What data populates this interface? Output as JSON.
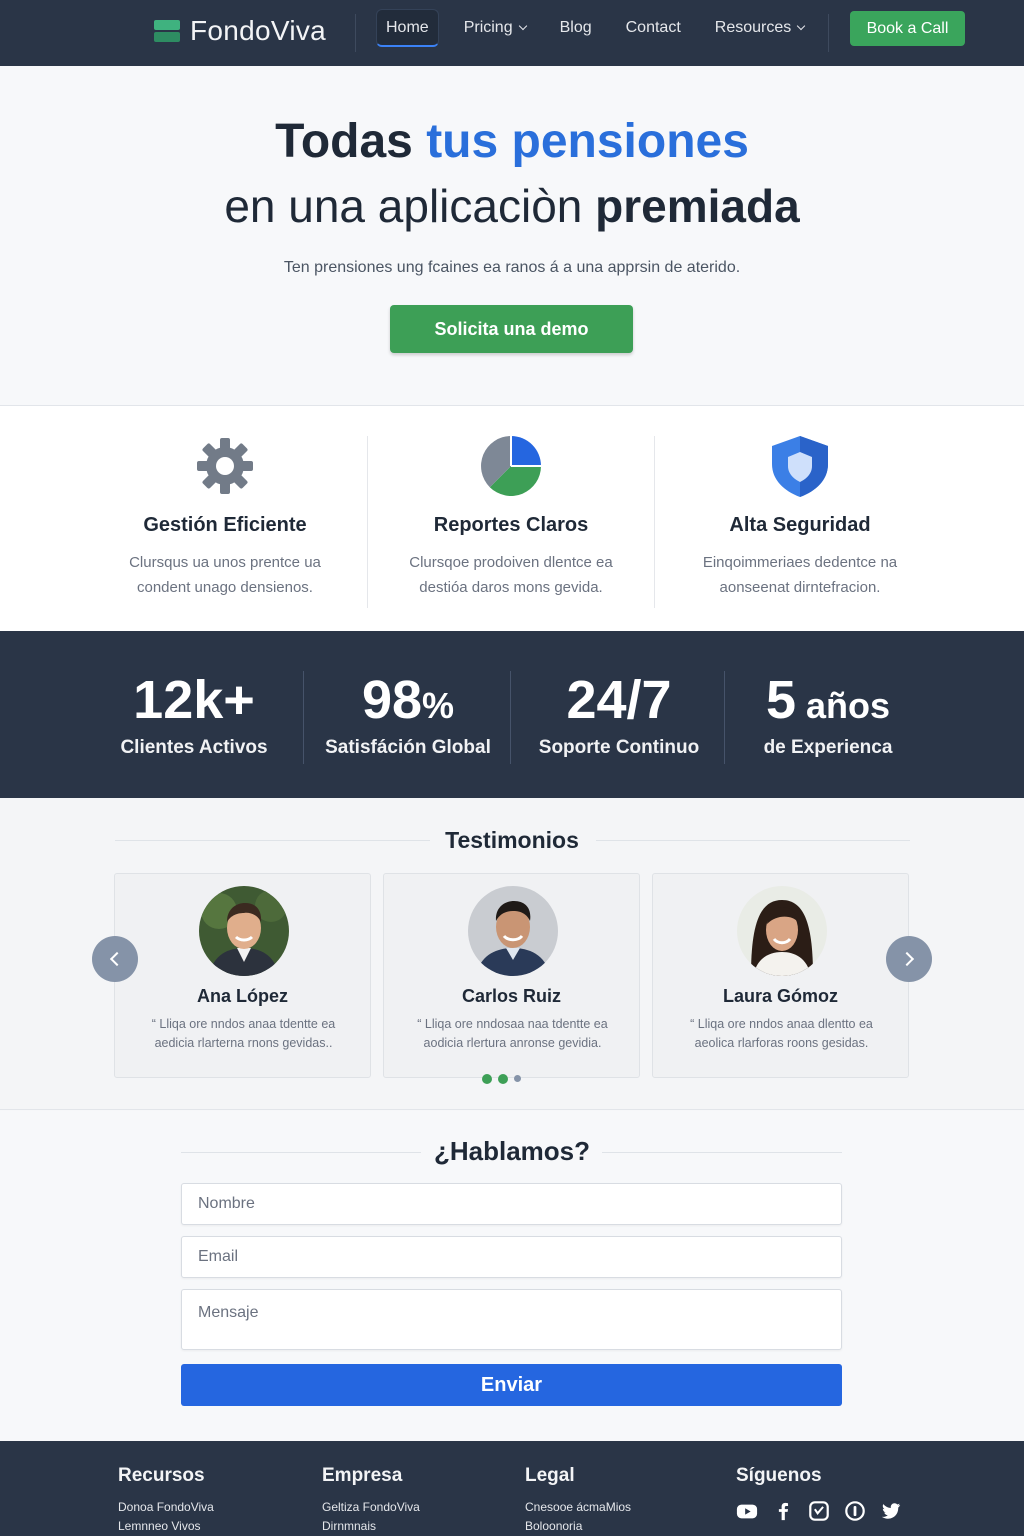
{
  "nav": {
    "brand": "FondoViva",
    "links": [
      {
        "label": "Home"
      },
      {
        "label": "Pricing"
      },
      {
        "label": "Blog"
      },
      {
        "label": "Contact"
      },
      {
        "label": "Resources"
      }
    ],
    "cta": "Book a Call"
  },
  "hero": {
    "title_part1": "Todas ",
    "title_accent": "tus pensiones",
    "title_line2_normal": "en una aplicaciòn ",
    "title_line2_bold": "premiada",
    "subtitle": "Ten prensiones ung fcaines ea ranos á a una apprsin de aterido.",
    "button": "Solicita una demo"
  },
  "features": [
    {
      "icon": "gear-icon",
      "title": "Gestión Eficiente",
      "line1": "Clursqus ua unos prentce ua",
      "line2": "condent unago densienos."
    },
    {
      "icon": "pie-chart-icon",
      "title": "Reportes Claros",
      "line1": "Clursqoe prodoiven dlentce ea",
      "line2": "destióa daros mons gevida."
    },
    {
      "icon": "shield-icon",
      "title": "Alta Seguridad",
      "line1": "Einqoimmeriaes dedentce na",
      "line2": "aonseenat dirntefracion."
    }
  ],
  "stats": [
    {
      "value": "12k+",
      "unit": "",
      "label": "Clientes Activos"
    },
    {
      "value": "98",
      "unit": "%",
      "label": "Satisfáción Global"
    },
    {
      "value": "24/7",
      "unit": "",
      "label": "Soporte Continuo"
    },
    {
      "value": "5",
      "unit": " años",
      "label": "de Experienca"
    }
  ],
  "testimonials": {
    "title": "Testimonios",
    "items": [
      {
        "name": "Ana López",
        "line1": "“ Lliqa ore nndos anaa tdentte ea",
        "line2": "aedicia rlarterna rnons gevidas.."
      },
      {
        "name": "Carlos Ruiz",
        "line1": "“ Lliqa ore nndosaa naa tdentte ea",
        "line2": "aodicia rlertura anronse gevidia."
      },
      {
        "name": "Laura Gómoz",
        "line1": "“ Lliqa ore nndos anaa dlentto ea",
        "line2": "aeolica rlarforas roons gesidas."
      }
    ],
    "active_index": 1
  },
  "contact": {
    "title": "¿Hablamos?",
    "name_placeholder": "Nombre",
    "email_placeholder": "Email",
    "message_placeholder": "Mensaje",
    "submit": "Enviar"
  },
  "footer": {
    "columns": [
      {
        "title": "Recursos",
        "links": [
          "Donoa FondoViva",
          "Lemnneo Vivos"
        ]
      },
      {
        "title": "Empresa",
        "links": [
          "Geltiza FondoViva",
          "Dirnmnais"
        ]
      },
      {
        "title": "Legal",
        "links": [
          "Cnesooe ácmaMios",
          "Boloonoria"
        ]
      }
    ],
    "social_title": "Síguenos",
    "social_icons": [
      "youtube-icon",
      "facebook-icon",
      "instagram-icon",
      "pinterest-icon",
      "twitter-icon"
    ]
  },
  "colors": {
    "nav_bg": "#2a3547",
    "accent_blue": "#2a6fdb",
    "accent_green": "#3d9f56",
    "submit_blue": "#2566e0"
  }
}
